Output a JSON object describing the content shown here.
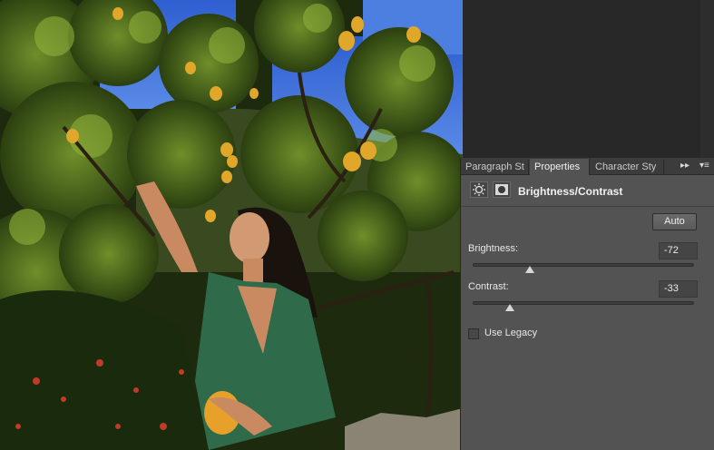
{
  "tabs": [
    {
      "label": "Paragraph St",
      "active": false
    },
    {
      "label": "Properties",
      "active": true
    },
    {
      "label": "Character Sty",
      "active": false
    }
  ],
  "tab_icons": {
    "expand": "double-chevron-right-icon",
    "menu": "panel-menu-icon"
  },
  "header": {
    "title": "Brightness/Contrast",
    "icons": [
      "brightness-adjustment-icon",
      "layer-mask-icon"
    ]
  },
  "auto_label": "Auto",
  "brightness": {
    "label": "Brightness:",
    "value": "-72",
    "min": -150,
    "max": 150
  },
  "contrast": {
    "label": "Contrast:",
    "value": "-33",
    "min": -50,
    "max": 100
  },
  "legacy": {
    "label": "Use Legacy",
    "checked": false
  },
  "colors": {
    "panel": "#535353",
    "workspace": "#282828",
    "accent_text": "#f0f0f0"
  }
}
